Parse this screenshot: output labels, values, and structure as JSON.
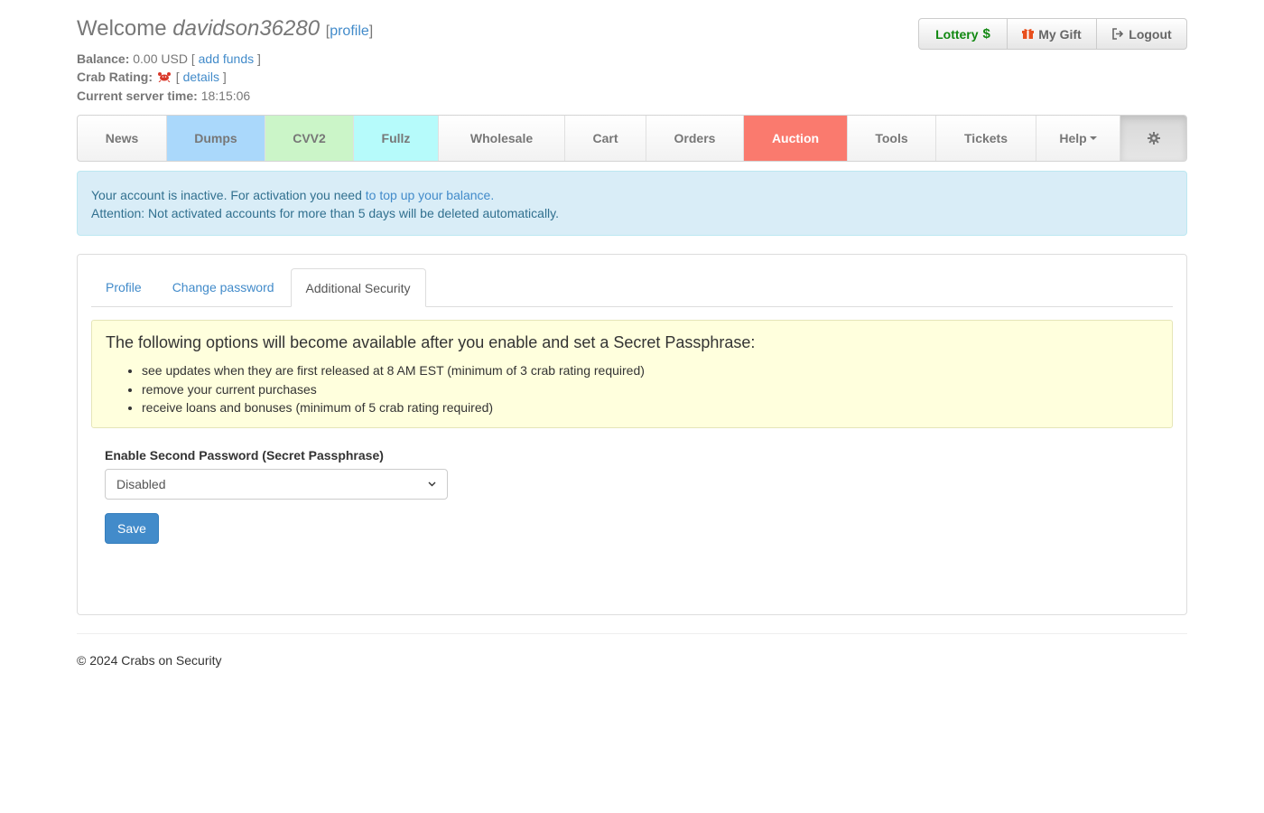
{
  "header": {
    "welcome": "Welcome",
    "username": "davidson36280",
    "profile_link": "profile",
    "balance_label": "Balance:",
    "balance_value": "0.00 USD",
    "add_funds": "add funds",
    "crab_label": "Crab Rating:",
    "details": "details",
    "time_label": "Current server time:",
    "time_value": "18:15:06",
    "buttons": {
      "lottery": "Lottery",
      "gift": "My Gift",
      "logout": "Logout"
    }
  },
  "nav": {
    "items": [
      {
        "label": "News",
        "color": "#f2f2f2"
      },
      {
        "label": "Dumps",
        "color": "#aad8fb"
      },
      {
        "label": "CVV2",
        "color": "#cbf5c8"
      },
      {
        "label": "Fullz",
        "color": "#b6fbfb"
      },
      {
        "label": "Wholesale",
        "color": "#f2f2f2"
      },
      {
        "label": "Cart",
        "color": "#f2f2f2"
      },
      {
        "label": "Orders",
        "color": "#f2f2f2"
      },
      {
        "label": "Auction",
        "color": "#fa7a6e"
      },
      {
        "label": "Tools",
        "color": "#f2f2f2"
      },
      {
        "label": "Tickets",
        "color": "#f2f2f2"
      },
      {
        "label": "Help",
        "color": "#f2f2f2"
      }
    ],
    "settings_icon": "gear-icon"
  },
  "alert": {
    "text1": "Your account is inactive. For activation you need",
    "link": "to top up your balance.",
    "text2": "Attention: Not activated accounts for more than 5 days will be deleted automatically."
  },
  "tabs": [
    "Profile",
    "Change password",
    "Additional Security"
  ],
  "note": {
    "heading": "The following options will become available after you enable and set a Secret Passphrase:",
    "items": [
      "see updates when they are first released at 8 AM EST (minimum of 3 crab rating required)",
      "remove your current purchases",
      "receive loans and bonuses (minimum of 5 crab rating required)"
    ]
  },
  "form": {
    "label": "Enable Second Password (Secret Passphrase)",
    "select_value": "Disabled",
    "save": "Save"
  },
  "footer": "© 2024 Crabs on Security"
}
